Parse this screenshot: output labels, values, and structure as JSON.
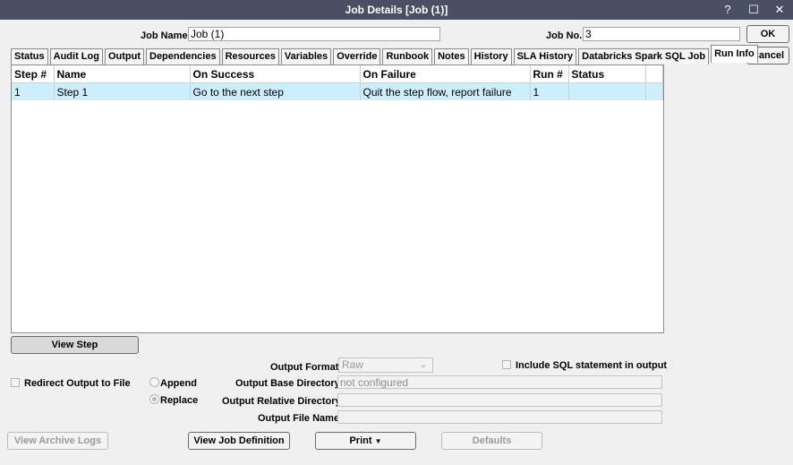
{
  "window": {
    "title": "Job Details [Job (1)]",
    "help_icon": "?",
    "maximize_icon": "☐",
    "close_icon": "✕"
  },
  "header": {
    "job_name_label": "Job Name",
    "job_name_value": "Job (1)",
    "job_no_label": "Job No.",
    "job_no_value": "3",
    "ok_label": "OK",
    "cancel_label": "Cancel"
  },
  "tabs": [
    {
      "label": "Status"
    },
    {
      "label": "Audit Log"
    },
    {
      "label": "Output"
    },
    {
      "label": "Dependencies"
    },
    {
      "label": "Resources"
    },
    {
      "label": "Variables"
    },
    {
      "label": "Override"
    },
    {
      "label": "Runbook"
    },
    {
      "label": "Notes"
    },
    {
      "label": "History"
    },
    {
      "label": "SLA History"
    },
    {
      "label": "Databricks Spark SQL Job"
    },
    {
      "label": "Run Info"
    }
  ],
  "grid": {
    "columns": [
      "Step #",
      "Name",
      "On Success",
      "On Failure",
      "Run #",
      "Status"
    ],
    "rows": [
      {
        "step": "1",
        "name": "Step 1",
        "on_success": "Go to the next step",
        "on_failure": "Quit the step flow, report failure",
        "run": "1",
        "status": ""
      }
    ]
  },
  "view_step_label": "View Step",
  "output": {
    "redirect_label": "Redirect Output to File",
    "append_label": "Append",
    "replace_label": "Replace",
    "format_label": "Output Format",
    "format_value": "Raw",
    "include_sql_label": "Include SQL statement in output",
    "base_dir_label": "Output Base Directory",
    "base_dir_value": "not configured",
    "rel_dir_label": "Output Relative Directory",
    "rel_dir_value": "",
    "file_name_label": "Output File Name",
    "file_name_value": ""
  },
  "footer": {
    "view_archive_logs": "View Archive Logs",
    "view_job_definition": "View Job Definition",
    "print": "Print",
    "defaults": "Defaults"
  }
}
